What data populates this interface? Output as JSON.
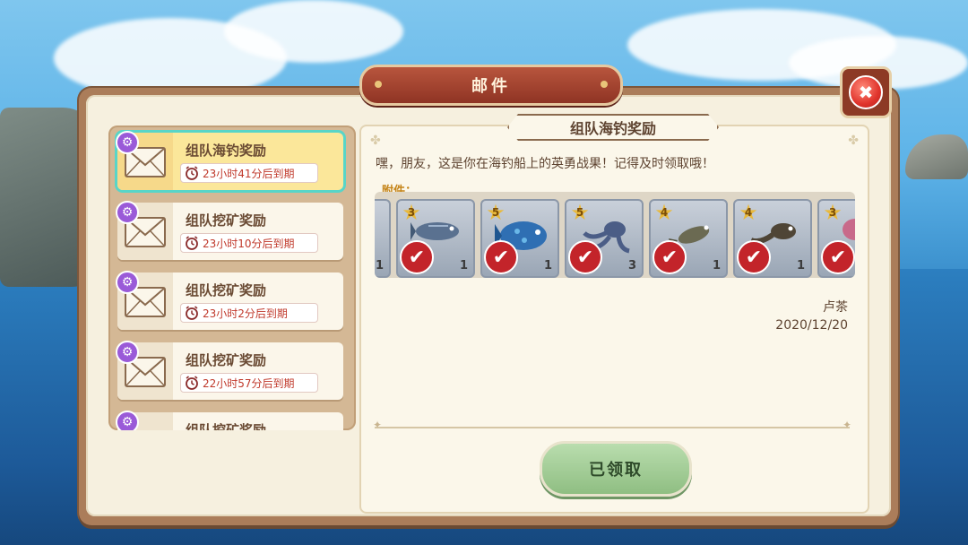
{
  "window": {
    "title": "邮件"
  },
  "mail_list": [
    {
      "title": "组队海钓奖励",
      "expire": "23小时41分后到期",
      "selected": true
    },
    {
      "title": "组队挖矿奖励",
      "expire": "23小时10分后到期",
      "selected": false
    },
    {
      "title": "组队挖矿奖励",
      "expire": "23小时2分后到期",
      "selected": false
    },
    {
      "title": "组队挖矿奖励",
      "expire": "22小时57分后到期",
      "selected": false
    },
    {
      "title": "组队挖矿奖励",
      "expire": "",
      "selected": false
    }
  ],
  "detail": {
    "title": "组队海钓奖励",
    "message": "嘿，朋友，这是你在海钓船上的英勇战果！记得及时领取哦！",
    "attachments_label": "附件：",
    "attachments": [
      {
        "stars": "",
        "qty": "1",
        "icon": "fish-partial-icon",
        "color": "#7d8da8"
      },
      {
        "stars": "3",
        "qty": "1",
        "icon": "tuna-fish-icon",
        "color": "#5a7190"
      },
      {
        "stars": "5",
        "qty": "1",
        "icon": "blue-parrotfish-icon",
        "color": "#2f6fb3"
      },
      {
        "stars": "5",
        "qty": "3",
        "icon": "octopus-icon",
        "color": "#4b5d86"
      },
      {
        "stars": "4",
        "qty": "1",
        "icon": "small-fish-icon",
        "color": "#6b6a52"
      },
      {
        "stars": "4",
        "qty": "1",
        "icon": "tadpole-fish-icon",
        "color": "#4f4536"
      },
      {
        "stars": "3",
        "qty": "",
        "icon": "pink-item-icon",
        "color": "#c8698a"
      }
    ],
    "sender": "卢茶",
    "date": "2020/12/20",
    "claim_button": "已领取"
  },
  "colors": {
    "selected_highlight": "#58d5c8",
    "expire_text": "#c0392b",
    "title_plate": "#8f3424",
    "claim_button": "#9fca92"
  }
}
